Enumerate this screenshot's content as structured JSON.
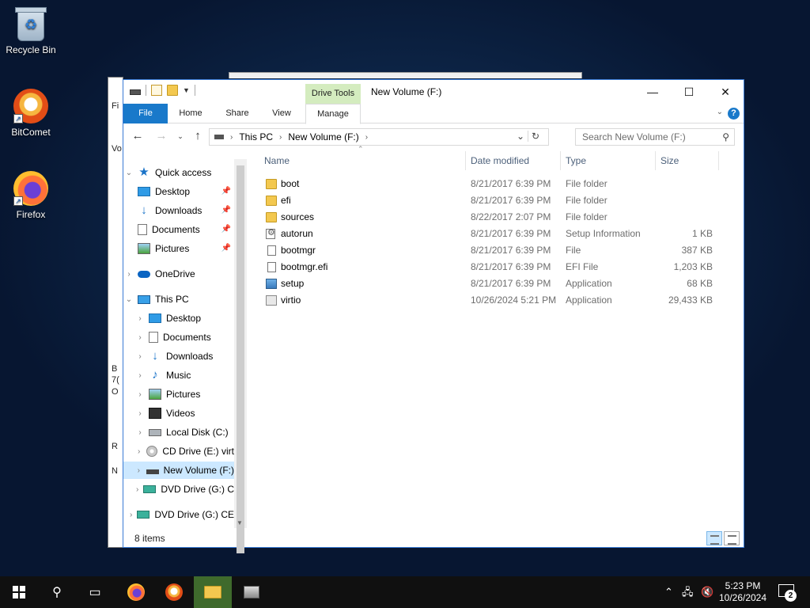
{
  "desktop": {
    "icons": [
      {
        "label": "Recycle Bin",
        "icon": "recycle-bin-icon"
      },
      {
        "label": "BitComet",
        "icon": "bitcomet-icon"
      },
      {
        "label": "Firefox",
        "icon": "firefox-icon"
      }
    ]
  },
  "background_window": {
    "fragments": [
      "Fi",
      "Vo",
      "B",
      "7(",
      "O",
      "R",
      "N"
    ]
  },
  "window": {
    "title": "New Volume (F:)",
    "contextual_tab": "Drive Tools",
    "tabs": [
      "File",
      "Home",
      "Share",
      "View",
      "Manage"
    ],
    "controls": {
      "minimize": "—",
      "maximize": "☐",
      "close": "✕"
    },
    "help": "?"
  },
  "address": {
    "crumbs": [
      "This PC",
      "New Volume (F:)"
    ],
    "search_placeholder": "Search New Volume (F:)"
  },
  "nav": {
    "items": [
      {
        "label": "Quick access",
        "icon": "star-icon",
        "chevron": "⌄"
      },
      {
        "label": "Desktop",
        "icon": "desktop-icon",
        "pinned": true
      },
      {
        "label": "Downloads",
        "icon": "download-icon",
        "pinned": true
      },
      {
        "label": "Documents",
        "icon": "documents-icon",
        "pinned": true
      },
      {
        "label": "Pictures",
        "icon": "pictures-icon",
        "pinned": true
      },
      {
        "label": "OneDrive",
        "icon": "onedrive-icon",
        "chevron": "›"
      },
      {
        "label": "This PC",
        "icon": "this-pc-icon",
        "chevron": "⌄"
      },
      {
        "label": "Desktop",
        "icon": "desktop-icon",
        "chevron": "›"
      },
      {
        "label": "Documents",
        "icon": "documents-icon",
        "chevron": "›"
      },
      {
        "label": "Downloads",
        "icon": "download-icon",
        "chevron": "›"
      },
      {
        "label": "Music",
        "icon": "music-icon",
        "chevron": "›"
      },
      {
        "label": "Pictures",
        "icon": "pictures-icon",
        "chevron": "›"
      },
      {
        "label": "Videos",
        "icon": "videos-icon",
        "chevron": "›"
      },
      {
        "label": "Local Disk (C:)",
        "icon": "hard-disk-icon",
        "chevron": "›"
      },
      {
        "label": "CD Drive (E:) virt",
        "icon": "cd-drive-icon",
        "chevron": "›"
      },
      {
        "label": "New Volume (F:)",
        "icon": "volume-icon",
        "chevron": "›",
        "selected": true
      },
      {
        "label": "DVD Drive (G:) C",
        "icon": "dvd-drive-icon",
        "chevron": "›"
      },
      {
        "label": "DVD Drive (G:) CE",
        "icon": "dvd-drive-icon",
        "chevron": "›"
      }
    ]
  },
  "list": {
    "columns": [
      "Name",
      "Date modified",
      "Type",
      "Size"
    ],
    "rows": [
      {
        "name": "boot",
        "date": "8/21/2017 6:39 PM",
        "type": "File folder",
        "size": "",
        "icon": "folder-icon"
      },
      {
        "name": "efi",
        "date": "8/21/2017 6:39 PM",
        "type": "File folder",
        "size": "",
        "icon": "folder-icon"
      },
      {
        "name": "sources",
        "date": "8/22/2017 2:07 PM",
        "type": "File folder",
        "size": "",
        "icon": "folder-icon"
      },
      {
        "name": "autorun",
        "date": "8/21/2017 6:39 PM",
        "type": "Setup Information",
        "size": "1 KB",
        "icon": "setup-info-icon"
      },
      {
        "name": "bootmgr",
        "date": "8/21/2017 6:39 PM",
        "type": "File",
        "size": "387 KB",
        "icon": "file-icon"
      },
      {
        "name": "bootmgr.efi",
        "date": "8/21/2017 6:39 PM",
        "type": "EFI File",
        "size": "1,203 KB",
        "icon": "file-icon"
      },
      {
        "name": "setup",
        "date": "8/21/2017 6:39 PM",
        "type": "Application",
        "size": "68 KB",
        "icon": "application-icon"
      },
      {
        "name": "virtio",
        "date": "10/26/2024 5:21 PM",
        "type": "Application",
        "size": "29,433 KB",
        "icon": "application-icon"
      }
    ]
  },
  "status": {
    "item_count": "8 items"
  },
  "taskbar": {
    "apps": [
      "start-icon",
      "search-icon",
      "task-view-icon",
      "firefox-icon",
      "bitcomet-icon",
      "file-explorer-icon",
      "setup-icon"
    ],
    "time": "5:23 PM",
    "date": "10/26/2024",
    "notification_count": "2"
  }
}
